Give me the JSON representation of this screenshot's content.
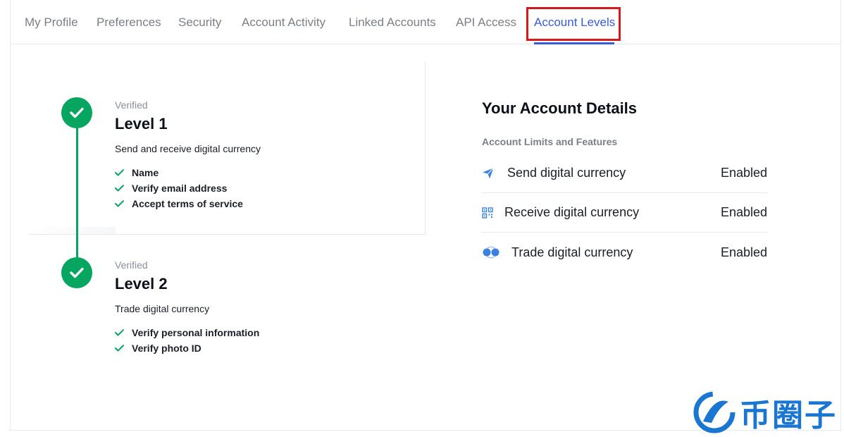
{
  "tabs": [
    {
      "label": "My Profile"
    },
    {
      "label": "Preferences"
    },
    {
      "label": "Security"
    },
    {
      "label": "Account Activity"
    },
    {
      "label": "Linked Accounts"
    },
    {
      "label": "API Access"
    },
    {
      "label": "Account Levels"
    }
  ],
  "active_tab": "Account Levels",
  "levels": [
    {
      "status": "Verified",
      "title": "Level 1",
      "description": "Send and receive digital currency",
      "requirements": [
        "Name",
        "Verify email address",
        "Accept terms of service"
      ]
    },
    {
      "status": "Verified",
      "title": "Level 2",
      "description": "Trade digital currency",
      "requirements": [
        "Verify personal information",
        "Verify photo ID"
      ]
    }
  ],
  "details": {
    "title": "Your Account Details",
    "subtitle": "Account Limits and Features",
    "features": [
      {
        "icon": "paper-plane-icon",
        "label": "Send digital currency",
        "status": "Enabled"
      },
      {
        "icon": "qr-code-icon",
        "label": "Receive digital currency",
        "status": "Enabled"
      },
      {
        "icon": "trade-circles-icon",
        "label": "Trade digital currency",
        "status": "Enabled"
      }
    ]
  },
  "watermark": {
    "text": "币圈子"
  },
  "colors": {
    "accent": "#3a5bd9",
    "success": "#06a560",
    "highlight": "#d7191c",
    "watermark": "#1976d2"
  }
}
